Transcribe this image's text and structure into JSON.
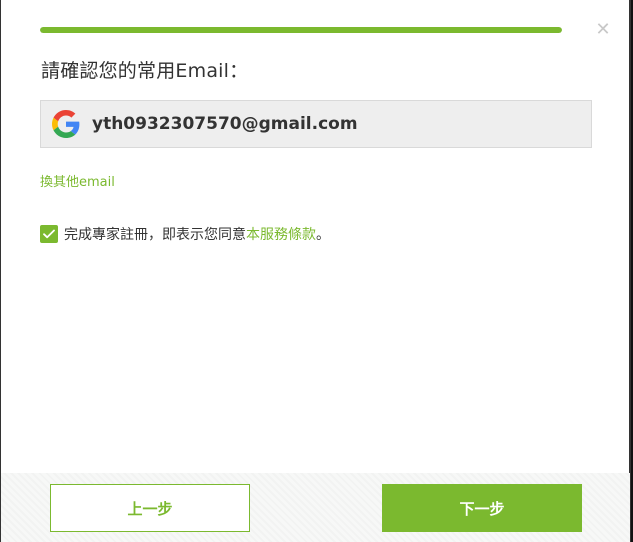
{
  "progress": {
    "fraction": 1.0,
    "color": "#7bb92f"
  },
  "close_icon": "close-icon",
  "title": "請確認您的常用Email：",
  "account": {
    "provider_icon": "google-icon",
    "email": "yth0932307570@gmail.com"
  },
  "switch_email_label": "換其他email",
  "agreement": {
    "checked": true,
    "text": "完成專家註冊，即表示您同意",
    "terms_link": "本服務條款",
    "suffix": "。"
  },
  "buttons": {
    "prev_label": "上一步",
    "next_label": "下一步"
  },
  "colors": {
    "accent": "#7bb92f"
  }
}
